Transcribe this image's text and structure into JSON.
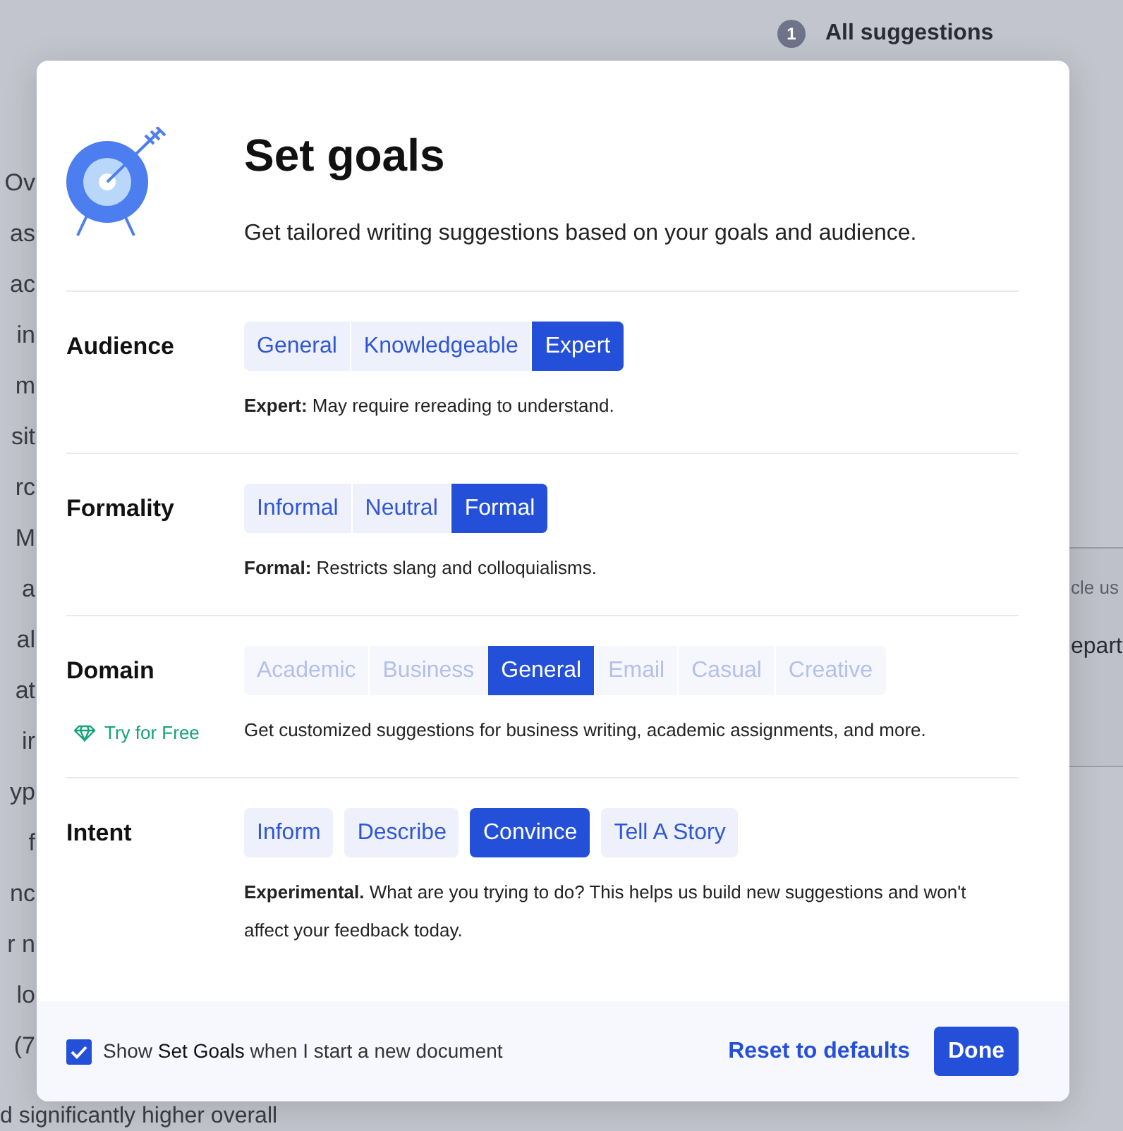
{
  "top_bar": {
    "count": "1",
    "title": "All suggestions"
  },
  "background_lines": [
    "Ov",
    "as",
    "ac",
    "in",
    "m",
    "sit",
    "rc",
    "M",
    "a",
    "al",
    "at",
    "ir",
    "yp",
    "f",
    "nc",
    "r n",
    "lo",
    "(7"
  ],
  "background_footer_line": "d significantly higher overall",
  "side_card": {
    "lines": [
      "cle us",
      "epart"
    ]
  },
  "dialog": {
    "title": "Set goals",
    "subtitle": "Get tailored writing suggestions based on your goals and audience.",
    "sections": [
      {
        "label": "Audience",
        "kind": "joined",
        "options": [
          {
            "label": "General",
            "selected": false,
            "disabled": false
          },
          {
            "label": "Knowledgeable",
            "selected": false,
            "disabled": false
          },
          {
            "label": "Expert",
            "selected": true,
            "disabled": false
          }
        ],
        "description": "**Expert:** May require rereading to understand."
      },
      {
        "label": "Formality",
        "kind": "joined",
        "options": [
          {
            "label": "Informal",
            "selected": false,
            "disabled": false
          },
          {
            "label": "Neutral",
            "selected": false,
            "disabled": false
          },
          {
            "label": "Formal",
            "selected": true,
            "disabled": false
          }
        ],
        "description": "**Formal:** Restricts slang and colloquialisms."
      },
      {
        "label": "Domain",
        "kind": "joined",
        "upsell": "Try for Free",
        "options": [
          {
            "label": "Academic",
            "selected": false,
            "disabled": true
          },
          {
            "label": "Business",
            "selected": false,
            "disabled": true
          },
          {
            "label": "General",
            "selected": true,
            "disabled": false
          },
          {
            "label": "Email",
            "selected": false,
            "disabled": true
          },
          {
            "label": "Casual",
            "selected": false,
            "disabled": true
          },
          {
            "label": "Creative",
            "selected": false,
            "disabled": true
          }
        ],
        "description": "Get customized suggestions for business writing, academic assignments, and more."
      },
      {
        "label": "Intent",
        "kind": "spaced",
        "options": [
          {
            "label": "Inform",
            "selected": false,
            "disabled": false
          },
          {
            "label": "Describe",
            "selected": false,
            "disabled": false
          },
          {
            "label": "Convince",
            "selected": true,
            "disabled": false
          },
          {
            "label": "Tell A Story",
            "selected": false,
            "disabled": false
          }
        ],
        "description": "**Experimental.** What are you trying to do? This helps us build new suggestions and won't affect your feedback today."
      }
    ],
    "footer": {
      "checkbox": {
        "label": "Show **Set Goals** when I start a new document",
        "checked": true
      },
      "reset": "Reset to defaults",
      "done": "Done"
    }
  }
}
